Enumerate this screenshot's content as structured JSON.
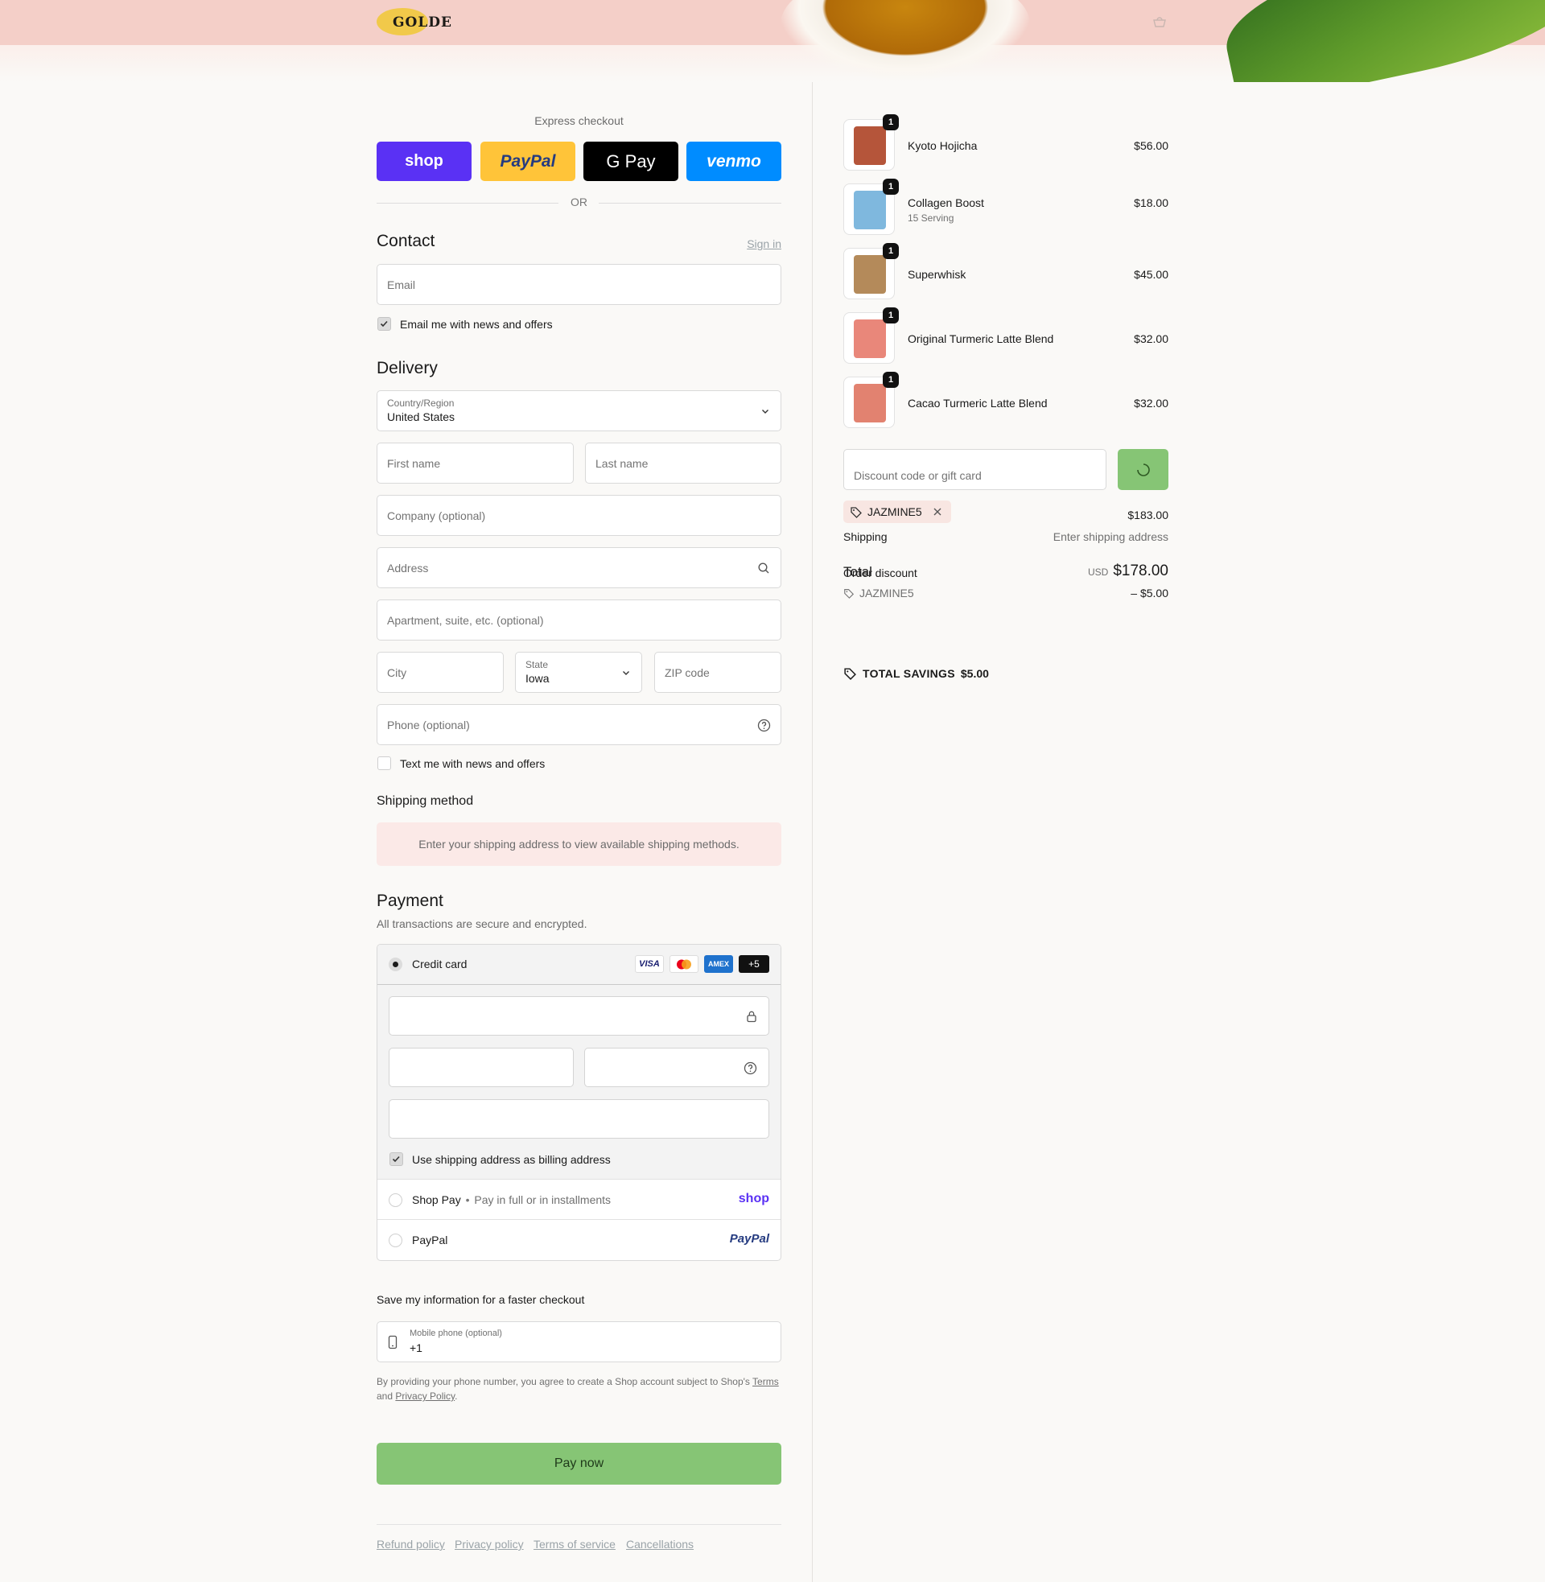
{
  "header": {
    "logo_text": "GOLDE"
  },
  "express": {
    "title": "Express checkout",
    "buttons": [
      "shop",
      "PayPal",
      "G Pay",
      "venmo"
    ],
    "or_label": "OR"
  },
  "contact": {
    "title": "Contact",
    "sign_in": "Sign in",
    "email_placeholder": "Email",
    "newsletter_label": "Email me with news and offers"
  },
  "delivery": {
    "title": "Delivery",
    "country_label": "Country/Region",
    "country_value": "United States",
    "first_name": "First name",
    "last_name": "Last name",
    "company": "Company (optional)",
    "address": "Address",
    "apartment": "Apartment, suite, etc. (optional)",
    "city": "City",
    "state_label": "State",
    "state_value": "Iowa",
    "zip": "ZIP code",
    "phone": "Phone (optional)",
    "sms_label": "Text me with news and offers"
  },
  "shipping_method": {
    "title": "Shipping method",
    "notice": "Enter your shipping address to view available shipping methods."
  },
  "payment": {
    "title": "Payment",
    "subtitle": "All transactions are secure and encrypted.",
    "credit_card_label": "Credit card",
    "card_brands": [
      "VISA",
      "mastercard",
      "AMEX",
      "+5"
    ],
    "billing_same_label": "Use shipping address as billing address",
    "shop_pay_label": "Shop Pay",
    "shop_pay_sep": "•",
    "shop_pay_desc": "Pay in full or in installments",
    "shop_pay_logo": "shop",
    "paypal_label": "PayPal",
    "paypal_logo": "PayPal"
  },
  "save_info": {
    "title": "Save my information for a faster checkout",
    "mobile_label": "Mobile phone (optional)",
    "mobile_value": "+1",
    "legal_1": "By providing your phone number, you agree to create a Shop account subject to Shop's",
    "terms": "Terms",
    "legal_and": "and",
    "privacy": "Privacy Policy",
    "legal_end": "."
  },
  "pay_now": "Pay now",
  "footer_links": [
    "Refund policy",
    "Privacy policy",
    "Terms of service",
    "Cancellations"
  ],
  "order": {
    "items": [
      {
        "name": "Kyoto Hojicha",
        "sub": "",
        "price": "$56.00",
        "qty": "1",
        "color": "#b5553a"
      },
      {
        "name": "Collagen Boost",
        "sub": "15 Serving",
        "price": "$18.00",
        "qty": "1",
        "color": "#7fb8de"
      },
      {
        "name": "Superwhisk",
        "sub": "",
        "price": "$45.00",
        "qty": "1",
        "color": "#b48a5a"
      },
      {
        "name": "Original Turmeric Latte Blend",
        "sub": "",
        "price": "$32.00",
        "qty": "1",
        "color": "#e9877a"
      },
      {
        "name": "Cacao Turmeric Latte Blend",
        "sub": "",
        "price": "$32.00",
        "qty": "1",
        "color": "#e28270"
      }
    ],
    "discount_placeholder": "Discount code or gift card",
    "code": "JAZMINE5",
    "subtotal": "$183.00",
    "shipping_label": "Shipping",
    "shipping_value": "Enter shipping address",
    "total_label": "Total",
    "order_discount_label": "Order discount",
    "currency": "USD",
    "total_value": "$178.00",
    "discount_code": "JAZMINE5",
    "discount_value": "– $5.00",
    "savings_label": "TOTAL SAVINGS",
    "savings_value": "$5.00"
  },
  "colors": {
    "pay_button": "#86c575",
    "shop_purple": "#5a31f4",
    "paypal_yellow": "#ffc439",
    "venmo_blue": "#008cff"
  }
}
